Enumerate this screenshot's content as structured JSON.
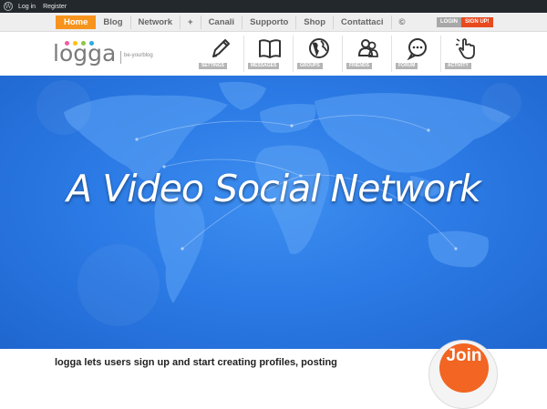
{
  "admin_bar": {
    "login": "Log in",
    "register": "Register"
  },
  "menu": {
    "items": [
      "Home",
      "Blog",
      "Network",
      "+",
      "Canali",
      "Supporto",
      "Shop",
      "Contattaci",
      "©"
    ]
  },
  "auth": {
    "login": "LOGIN",
    "signup": "SIGN UP!"
  },
  "logo": {
    "name": "logga",
    "tagline": "be-yourblog",
    "dot_colors": [
      "#f15a9f",
      "#ffc20e",
      "#8dc63f",
      "#29abe2"
    ]
  },
  "features": [
    {
      "label": "SETTINGS",
      "icon": "pencil-icon"
    },
    {
      "label": "MESSAGES",
      "icon": "book-icon"
    },
    {
      "label": "GROUPS",
      "icon": "globe-icon"
    },
    {
      "label": "FRIENDS",
      "icon": "users-icon"
    },
    {
      "label": "FORUM",
      "icon": "chat-bubble-icon"
    },
    {
      "label": "ACTIVITY",
      "icon": "hand-pointer-icon"
    }
  ],
  "hero": {
    "title": "A Video Social Network"
  },
  "intro": {
    "text": "logga lets users sign up and start creating profiles, posting"
  },
  "join": {
    "label": "Join"
  },
  "colors": {
    "accent": "#f7941d",
    "signup": "#e84a1e",
    "hero_blue": "#2c7be6",
    "join": "#f26522"
  }
}
